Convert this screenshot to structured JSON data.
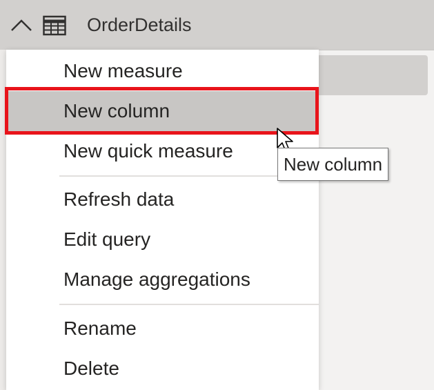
{
  "header": {
    "title": "OrderDetails",
    "collapse_icon": "chevron-up-icon",
    "table_icon": "table-icon"
  },
  "menu": {
    "items": [
      {
        "label": "New measure"
      },
      {
        "label": "New column",
        "highlighted": true
      },
      {
        "label": "New quick measure"
      },
      {
        "label": "Refresh data"
      },
      {
        "label": "Edit query"
      },
      {
        "label": "Manage aggregations"
      },
      {
        "label": "Rename"
      },
      {
        "label": "Delete"
      }
    ]
  },
  "tooltip": {
    "text": "New column"
  },
  "colors": {
    "annotation_red": "#e8141b",
    "hover_gray": "#c8c6c4",
    "header_gray": "#d2d0ce"
  }
}
